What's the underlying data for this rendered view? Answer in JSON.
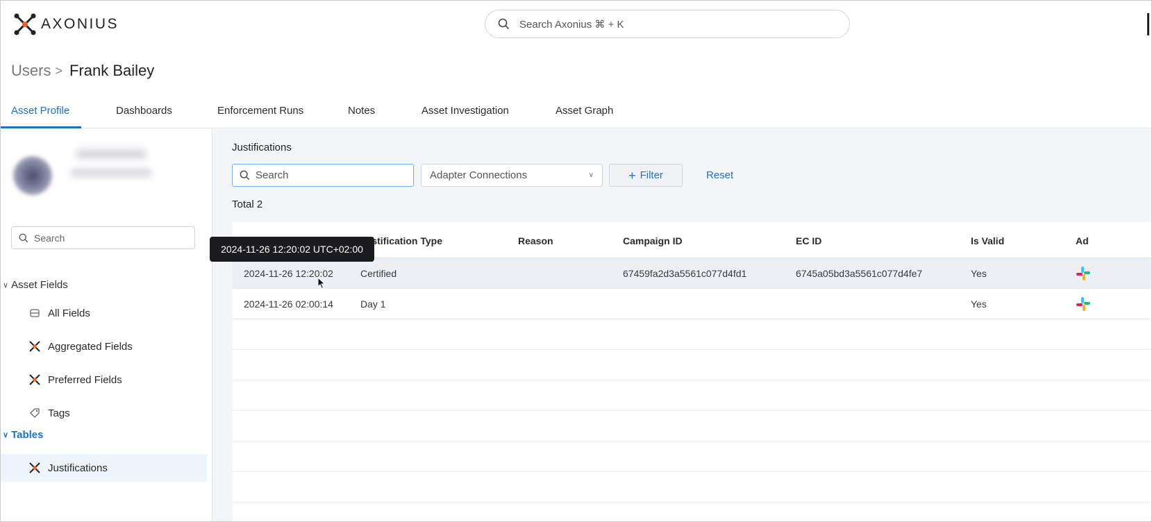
{
  "app": {
    "logo_text": "AXONIUS"
  },
  "global_search": {
    "placeholder": "Search Axonius ⌘ + K"
  },
  "breadcrumb": {
    "parent": "Users",
    "current": "Frank Bailey"
  },
  "tabs": [
    {
      "label": "Asset Profile",
      "active": true
    },
    {
      "label": "Dashboards"
    },
    {
      "label": "Enforcement Runs"
    },
    {
      "label": "Notes"
    },
    {
      "label": "Asset Investigation"
    },
    {
      "label": "Asset Graph"
    }
  ],
  "sidebar": {
    "search_placeholder": "Search",
    "sections": {
      "asset_fields": "Asset Fields",
      "tables": "Tables"
    },
    "items": [
      {
        "label": "All Fields",
        "icon": "box-icon"
      },
      {
        "label": "Aggregated Fields",
        "icon": "axonius-icon"
      },
      {
        "label": "Preferred Fields",
        "icon": "axonius-icon"
      },
      {
        "label": "Tags",
        "icon": "tags-icon"
      },
      {
        "label": "Justifications",
        "icon": "axonius-icon",
        "selected": true
      }
    ]
  },
  "main": {
    "title": "Justifications",
    "search_placeholder": "Search",
    "adapter_select": "Adapter Connections",
    "filter_label": "Filter",
    "reset_label": "Reset",
    "total_label": "Total 2",
    "columns": [
      "Justification Type",
      "Reason",
      "Campaign ID",
      "EC ID",
      "Is Valid",
      "Ad"
    ],
    "rows": [
      {
        "date": "2024-11-26 12:20:02",
        "type": "Certified",
        "reason": "",
        "campaign_id": "67459fa2d3a5561c077d4fd1",
        "ec_id": "6745a05bd3a5561c077d4fe7",
        "is_valid": "Yes",
        "adapter_icon": "slack-icon"
      },
      {
        "date": "2024-11-26 02:00:14",
        "type": "Day 1",
        "reason": "",
        "campaign_id": "",
        "ec_id": "",
        "is_valid": "Yes",
        "adapter_icon": "slack-icon"
      }
    ],
    "tooltip": "2024-11-26 12:20:02 UTC+02:00"
  },
  "colors": {
    "accent": "#1a73c9",
    "logo_orange": "#f0652f"
  }
}
